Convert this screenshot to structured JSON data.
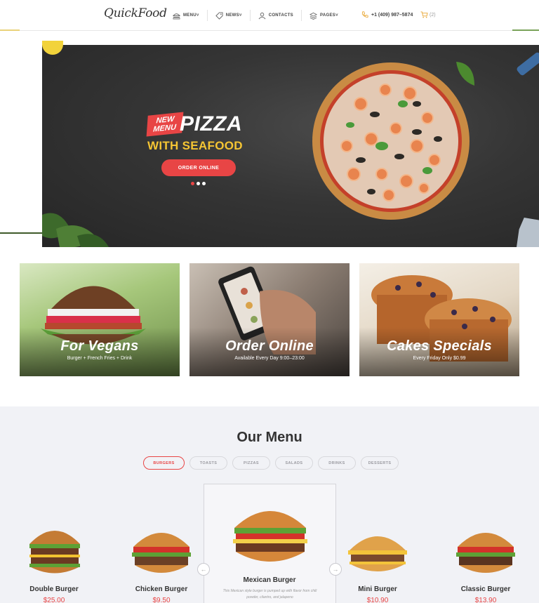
{
  "brand": {
    "logo_text": "QuickFood",
    "accent": "#e84545"
  },
  "nav": {
    "items": [
      {
        "label": "MENU",
        "icon": "burger-icon",
        "dropdown": true
      },
      {
        "label": "NEWS",
        "icon": "tag-icon",
        "dropdown": true
      },
      {
        "label": "CONTACTS",
        "icon": "user-icon",
        "dropdown": false
      },
      {
        "label": "PAGES",
        "icon": "layers-icon",
        "dropdown": true
      }
    ],
    "phone": "+1 (409) 987–5874",
    "cart_count": "(2)"
  },
  "hero": {
    "badge_line1": "NEW",
    "badge_line2": "MENU",
    "title": "PIZZA",
    "subtitle": "WITH SEAFOOD",
    "button": "ORDER ONLINE",
    "slides": 3,
    "active_slide": 1
  },
  "promos": [
    {
      "title": "For Vegans",
      "subtitle": "Burger + French Fries + Drink"
    },
    {
      "title": "Order Online",
      "subtitle": "Available Every Day 9:00–23:00"
    },
    {
      "title": "Cakes Specials",
      "subtitle": "Every Friday Only $0.99"
    }
  ],
  "menu": {
    "title": "Our Menu",
    "tabs": [
      "BURGERS",
      "TOASTS",
      "PIZZAS",
      "SALADS",
      "DRINKS",
      "DESSERTS"
    ],
    "active_tab": "BURGERS",
    "items": [
      {
        "name": "Double Burger",
        "price": "$25.00"
      },
      {
        "name": "Chicken Burger",
        "price": "$9.50"
      },
      {
        "name": "Mexican Burger",
        "price": "",
        "description": "This Mexican style burger is pumped up with flavor from chili powder, cilantro, and jalapeno"
      },
      {
        "name": "Mini Burger",
        "price": "$10.90"
      },
      {
        "name": "Classic Burger",
        "price": "$13.90"
      }
    ],
    "prev_arrow": "←",
    "next_arrow": "→"
  }
}
